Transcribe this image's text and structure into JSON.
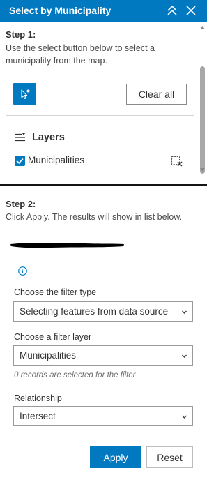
{
  "header": {
    "title": "Select by Municipality",
    "collapse_icon": "double-chevron-up-icon",
    "close_icon": "close-icon",
    "accent": "#0079c1"
  },
  "step1": {
    "title": "Step 1:",
    "desc_line1": "Use the select button below to select a",
    "desc_line2": "municipality from the map.",
    "select_tool_icon": "cursor-select-icon",
    "clear_all_label": "Clear all",
    "layers_title": "Layers",
    "layers_icon": "layers-list-icon",
    "layer_checked": true,
    "layer_name": "Municipalities",
    "clear_layer_icon": "clear-selection-icon"
  },
  "step2": {
    "title": "Step 2:",
    "desc": "Click Apply.  The results will show in list below.",
    "info_icon": "info-icon",
    "filter_type_label": "Choose the filter type",
    "filter_type_value": "Selecting features from data source",
    "filter_layer_label": "Choose a filter layer",
    "filter_layer_value": "Municipalities",
    "records_note": "0 records are selected for the filter",
    "relationship_label": "Relationship",
    "relationship_value": "Intersect",
    "apply_label": "Apply",
    "reset_label": "Reset"
  }
}
